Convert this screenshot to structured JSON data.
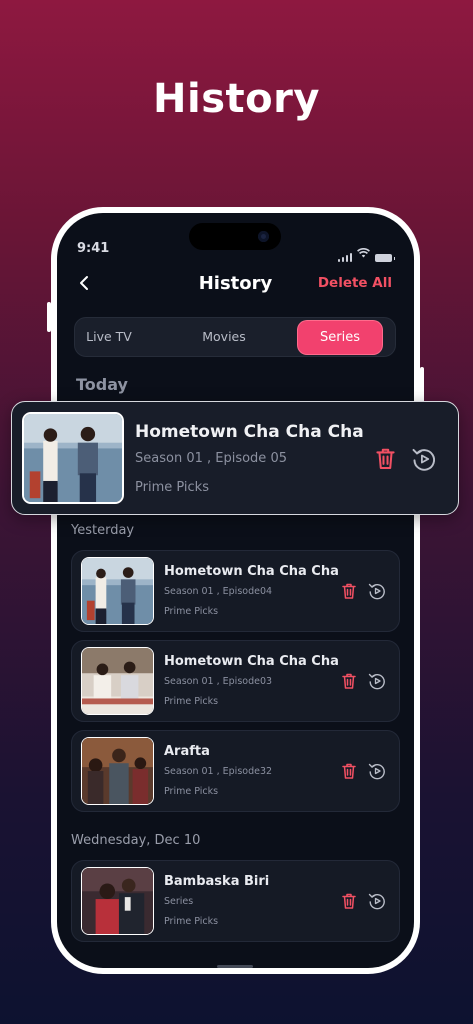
{
  "headline": "History",
  "status_bar": {
    "time": "9:41"
  },
  "nav": {
    "title": "History",
    "delete_all": "Delete All"
  },
  "tabs": [
    {
      "label": "Live TV",
      "selected": false
    },
    {
      "label": "Movies",
      "selected": false
    },
    {
      "label": "Series",
      "selected": true
    }
  ],
  "sections": {
    "today": "Today",
    "yesterday": "Yesterday",
    "wednesday": "Wednesday, Dec 10"
  },
  "featured": {
    "title": "Hometown Cha Cha Cha",
    "subtitle": "Season 01 , Episode 05",
    "provider": "Prime Picks"
  },
  "items": [
    {
      "title": "Hometown Cha Cha Cha",
      "subtitle": "Season 01 , Episode04",
      "provider": "Prime Picks"
    },
    {
      "title": "Hometown Cha Cha Cha",
      "subtitle": "Season 01 , Episode03",
      "provider": "Prime Picks"
    },
    {
      "title": "Arafta",
      "subtitle": "Season 01 , Episode32",
      "provider": "Prime Picks"
    },
    {
      "title": "Bambaska Biri",
      "subtitle": "Series",
      "provider": "Prime Picks"
    }
  ],
  "icons": {
    "delete": "trash-icon",
    "replay": "replay-icon",
    "back": "chevron-left-icon"
  },
  "colors": {
    "accent": "#f2416e",
    "delete": "#f25063",
    "background": "#0b0f19"
  }
}
